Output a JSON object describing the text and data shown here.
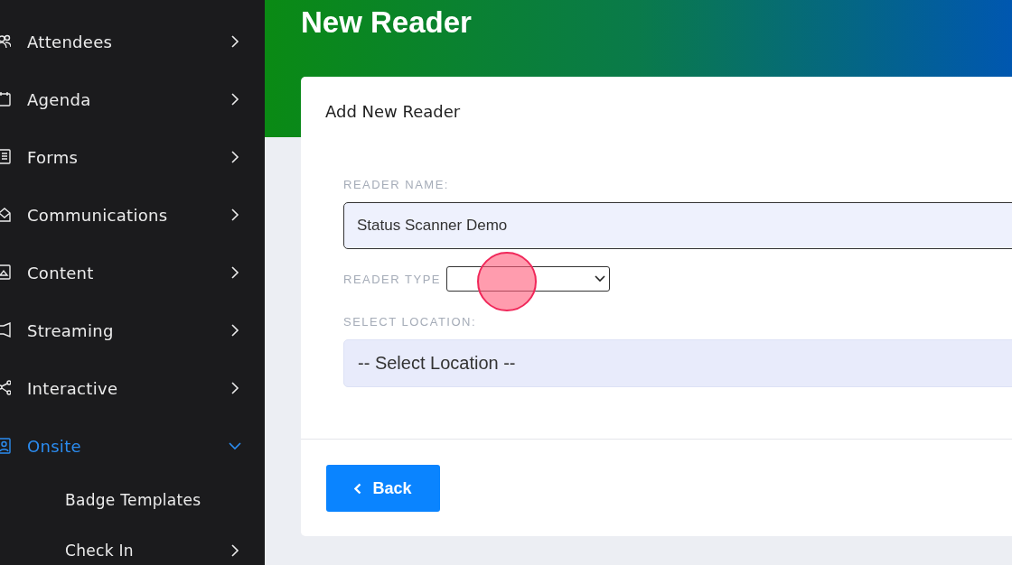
{
  "sidebar": {
    "items": [
      {
        "label": "Attendees",
        "selected": false,
        "expanded": false,
        "expandable": true
      },
      {
        "label": "Agenda",
        "selected": false,
        "expanded": false,
        "expandable": true
      },
      {
        "label": "Forms",
        "selected": false,
        "expanded": false,
        "expandable": true
      },
      {
        "label": "Communications",
        "selected": false,
        "expanded": false,
        "expandable": true
      },
      {
        "label": "Content",
        "selected": false,
        "expanded": false,
        "expandable": true
      },
      {
        "label": "Streaming",
        "selected": false,
        "expanded": false,
        "expandable": true
      },
      {
        "label": "Interactive",
        "selected": false,
        "expanded": false,
        "expandable": true
      },
      {
        "label": "Onsite",
        "selected": true,
        "expanded": true,
        "expandable": true,
        "children": [
          {
            "label": "Badge Templates",
            "expandable": false
          },
          {
            "label": "Check In",
            "expandable": true
          }
        ]
      }
    ]
  },
  "page": {
    "title": "New Reader"
  },
  "card": {
    "title": "Add New Reader",
    "fields": [
      {
        "kind": "text",
        "label": "READER NAME:",
        "value": "Status Scanner Demo"
      },
      {
        "kind": "inline-select",
        "label": "READER TYPE"
      },
      {
        "kind": "select",
        "label": "SELECT LOCATION:",
        "value": "-- Select Location --"
      }
    ],
    "back_button": "Back"
  }
}
